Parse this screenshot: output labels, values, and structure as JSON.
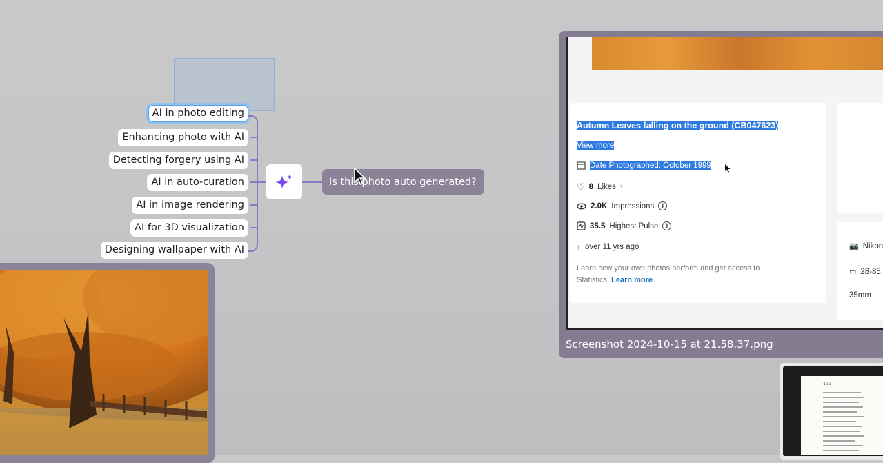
{
  "mindmap": {
    "nodes": [
      "AI in photo editing",
      "Enhancing photo with AI",
      "Detecting forgery using AI",
      "AI in auto-curation",
      "AI in image rendering",
      "AI for 3D visualization",
      "Designing wallpaper with AI"
    ],
    "ai_icon": "sparkle-icon",
    "query": "Is this photo auto generated?"
  },
  "screenshot": {
    "caption": "Screenshot 2024-10-15 at 21.58.37.png",
    "title": "Autumn Leaves falling on the ground (CB047623)",
    "view_more": "View more",
    "date": "Date Photographed: October 1999",
    "likes_count": "8",
    "likes_label": "Likes",
    "impressions_count": "2.0K",
    "impressions_label": "Impressions",
    "pulse_count": "35.5",
    "pulse_label": "Highest Pulse",
    "ago": "over 11 yrs ago",
    "learn_text": "Learn how your own photos perform and get access to",
    "learn_text2": "Statistics.",
    "learn_more": "Learn more",
    "camera": "Nikon",
    "lens": "28-85",
    "focal": "35mm"
  },
  "book": {
    "page_number": "452"
  },
  "colors": {
    "accent": "#8a78c2",
    "frame": "#8b8499",
    "highlight": "#2d7be0",
    "link": "#1a6fc4"
  }
}
